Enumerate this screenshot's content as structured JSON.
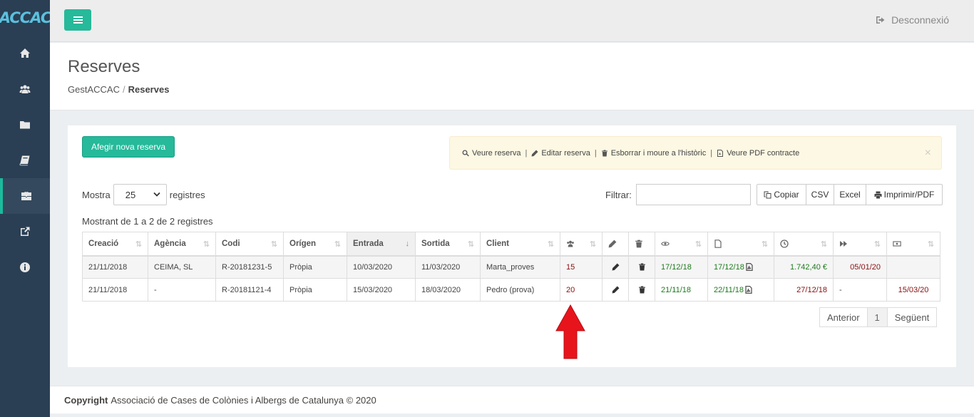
{
  "brand": {
    "logo_text": "ACCAC"
  },
  "sidebar": {
    "items": [
      {
        "icon": "home-icon"
      },
      {
        "icon": "users-icon"
      },
      {
        "icon": "folder-icon"
      },
      {
        "icon": "book-icon"
      },
      {
        "icon": "briefcase-icon",
        "active": true
      },
      {
        "icon": "external-link-icon"
      },
      {
        "icon": "info-icon"
      }
    ]
  },
  "topbar": {
    "logout_label": "Desconnexió"
  },
  "header": {
    "title": "Reserves",
    "breadcrumb_root": "GestACCAC",
    "breadcrumb_sep": "/",
    "breadcrumb_current": "Reserves"
  },
  "panel": {
    "add_button": "Afegir nova reserva",
    "legend": {
      "view": "Veure reserva",
      "edit": "Editar reserva",
      "delete": "Esborrar i moure a l'històric",
      "pdf": "Veure PDF contracte",
      "pipe": "|",
      "close": "×"
    },
    "length": {
      "prefix": "Mostra",
      "value": "25",
      "suffix": "registres"
    },
    "filter_label": "Filtrar:",
    "export": {
      "copy": "Copiar",
      "csv": "CSV",
      "excel": "Excel",
      "print": "Imprimir/PDF"
    },
    "info": "Mostrant de 1 a 2 de 2 registres",
    "pager": {
      "prev": "Anterior",
      "page": "1",
      "next": "Següent"
    }
  },
  "table": {
    "headers": {
      "created": "Creació",
      "agency": "Agència",
      "code": "Codi",
      "origin": "Orígen",
      "entry": "Entrada",
      "exit": "Sortida",
      "client": "Client"
    },
    "rows": [
      {
        "created": "21/11/2018",
        "agency": "CEIMA, SL",
        "code": "R-20181231-5",
        "origin": "Pròpia",
        "entry": "10/03/2020",
        "exit": "11/03/2020",
        "client": "Marta_proves",
        "people": "15",
        "viewed": "17/12/18",
        "contract": "17/12/18",
        "amount": "1.742,40 €",
        "next": "05/01/20",
        "paid": ""
      },
      {
        "created": "21/11/2018",
        "agency": "-",
        "code": "R-20181121-4",
        "origin": "Pròpia",
        "entry": "15/03/2020",
        "exit": "18/03/2020",
        "client": "Pedro (prova)",
        "people": "20",
        "viewed": "21/11/18",
        "contract": "22/11/18",
        "amount": "27/12/18",
        "next": "-",
        "paid": "15/03/20"
      }
    ]
  },
  "footer": {
    "bold": "Copyright",
    "text": "Associació de Cases de Colònies i Albergs de Catalunya © 2020"
  },
  "colors": {
    "accent": "#26b99a",
    "sidebar": "#2a3f54",
    "arrow": "#e8141b"
  }
}
